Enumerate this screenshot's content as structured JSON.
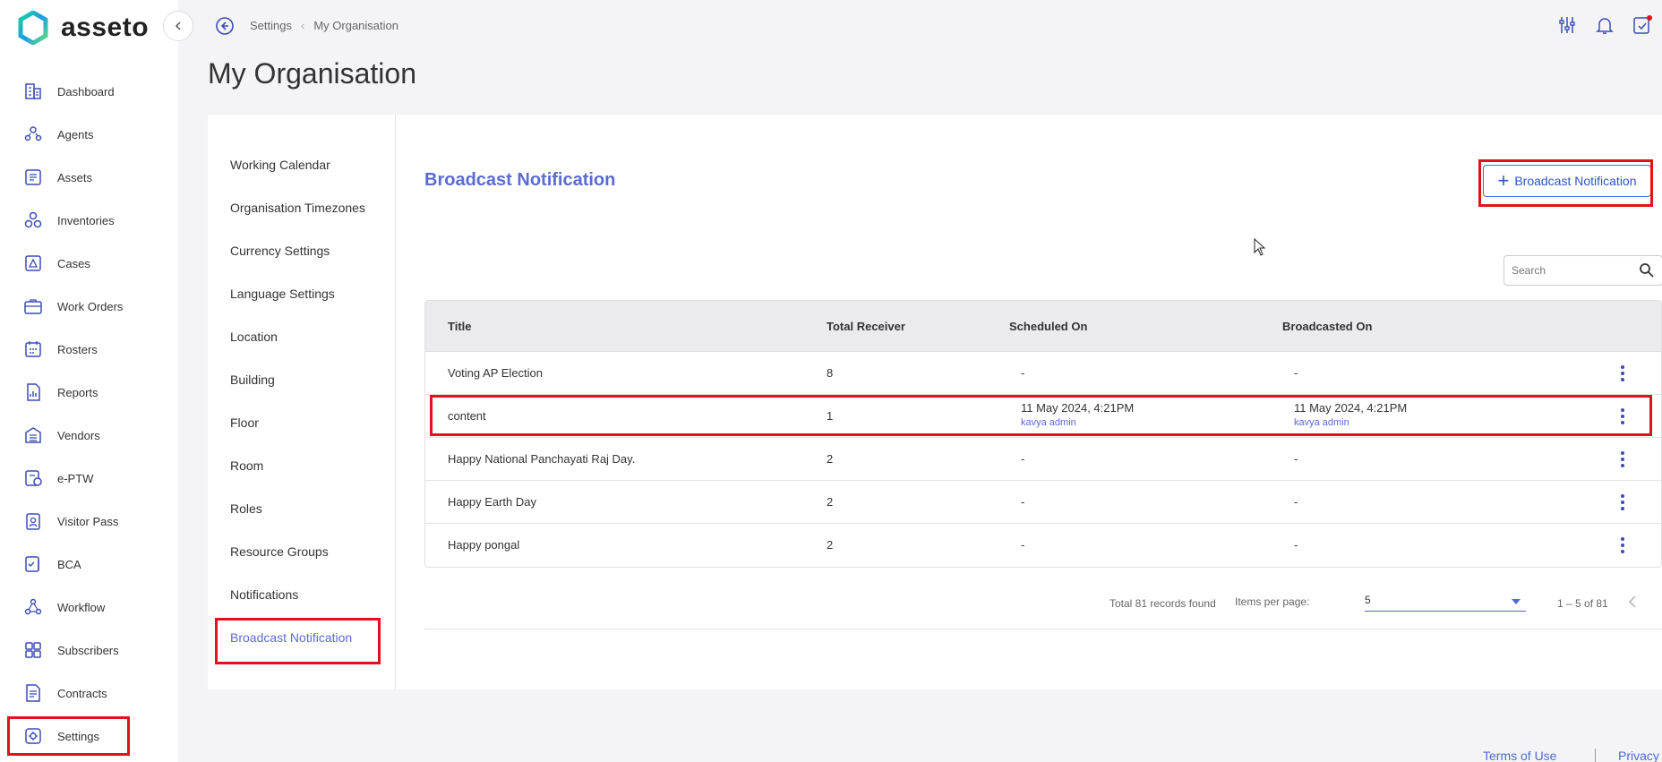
{
  "app": {
    "name": "asseto"
  },
  "sidebar": {
    "items": [
      {
        "label": "Dashboard",
        "icon": "building-icon"
      },
      {
        "label": "Agents",
        "icon": "agents-icon"
      },
      {
        "label": "Assets",
        "icon": "assets-icon"
      },
      {
        "label": "Inventories",
        "icon": "inventories-icon"
      },
      {
        "label": "Cases",
        "icon": "cases-icon"
      },
      {
        "label": "Work Orders",
        "icon": "briefcase-icon"
      },
      {
        "label": "Rosters",
        "icon": "calendar-icon"
      },
      {
        "label": "Reports",
        "icon": "reports-icon"
      },
      {
        "label": "Vendors",
        "icon": "vendors-icon"
      },
      {
        "label": "e-PTW",
        "icon": "eptw-icon"
      },
      {
        "label": "Visitor Pass",
        "icon": "badge-icon"
      },
      {
        "label": "BCA",
        "icon": "bca-icon"
      },
      {
        "label": "Workflow",
        "icon": "workflow-icon"
      },
      {
        "label": "Subscribers",
        "icon": "grid-icon"
      },
      {
        "label": "Contracts",
        "icon": "contracts-icon"
      },
      {
        "label": "Settings",
        "icon": "gear-icon",
        "active": true
      }
    ]
  },
  "breadcrumb": {
    "root": "Settings",
    "current": "My Organisation"
  },
  "page": {
    "title": "My Organisation"
  },
  "subnav": {
    "items": [
      "Working Calendar",
      "Organisation Timezones",
      "Currency Settings",
      "Language Settings",
      "Location",
      "Building",
      "Floor",
      "Room",
      "Roles",
      "Resource Groups",
      "Notifications",
      "Broadcast Notification"
    ],
    "active": "Broadcast Notification"
  },
  "section": {
    "title": "Broadcast Notification",
    "add_button": "Broadcast Notification",
    "search_placeholder": "Search"
  },
  "table": {
    "headers": [
      "Title",
      "Total Receiver",
      "Scheduled On",
      "Broadcasted On"
    ],
    "rows": [
      {
        "title": "Voting AP Election",
        "receivers": "8",
        "scheduled": "-",
        "scheduled_by": "",
        "broadcasted": "-",
        "broadcasted_by": ""
      },
      {
        "title": "content",
        "receivers": "1",
        "scheduled": "11 May 2024, 4:21PM",
        "scheduled_by": "kavya admin",
        "broadcasted": "11 May 2024, 4:21PM",
        "broadcasted_by": "kavya admin"
      },
      {
        "title": "Happy National Panchayati Raj Day.",
        "receivers": "2",
        "scheduled": "-",
        "scheduled_by": "",
        "broadcasted": "-",
        "broadcasted_by": ""
      },
      {
        "title": "Happy Earth Day",
        "receivers": "2",
        "scheduled": "-",
        "scheduled_by": "",
        "broadcasted": "-",
        "broadcasted_by": ""
      },
      {
        "title": "Happy pongal",
        "receivers": "2",
        "scheduled": "-",
        "scheduled_by": "",
        "broadcasted": "-",
        "broadcasted_by": ""
      }
    ]
  },
  "paginator": {
    "total": "Total 81 records found",
    "items_label": "Items per page:",
    "items_value": "5",
    "range": "1 – 5 of 81"
  },
  "footer": {
    "terms": "Terms of Use",
    "privacy": "Privacy"
  },
  "colors": {
    "accent": "#5b6bd5",
    "highlight": "#e0121b",
    "brand": "#22c9a8"
  }
}
